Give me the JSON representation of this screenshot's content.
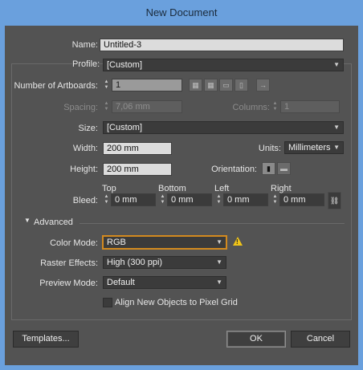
{
  "window": {
    "title": "New Document"
  },
  "name": {
    "label": "Name:",
    "value": "Untitled-3"
  },
  "profile": {
    "label": "Profile:",
    "value": "[Custom]"
  },
  "artboards": {
    "label": "Number of Artboards:",
    "value": "1"
  },
  "spacing": {
    "label": "Spacing:",
    "value": "7,06 mm"
  },
  "columns": {
    "label": "Columns:",
    "value": "1"
  },
  "size": {
    "label": "Size:",
    "value": "[Custom]"
  },
  "width": {
    "label": "Width:",
    "value": "200 mm"
  },
  "units": {
    "label": "Units:",
    "value": "Millimeters"
  },
  "height": {
    "label": "Height:",
    "value": "200 mm"
  },
  "orientation": {
    "label": "Orientation:"
  },
  "bleed": {
    "label": "Bleed:",
    "top_label": "Top",
    "top": "0 mm",
    "bottom_label": "Bottom",
    "bottom": "0 mm",
    "left_label": "Left",
    "left": "0 mm",
    "right_label": "Right",
    "right": "0 mm"
  },
  "advanced": {
    "label": "Advanced",
    "color_mode_label": "Color Mode:",
    "color_mode": "RGB",
    "raster_label": "Raster Effects:",
    "raster": "High (300 ppi)",
    "preview_label": "Preview Mode:",
    "preview": "Default",
    "align_label": "Align New Objects to Pixel Grid"
  },
  "buttons": {
    "templates": "Templates...",
    "ok": "OK",
    "cancel": "Cancel"
  },
  "colors": {
    "dialog_bg": "#535353",
    "title_bg": "#6aa0dd",
    "warning": "#f0c419"
  }
}
